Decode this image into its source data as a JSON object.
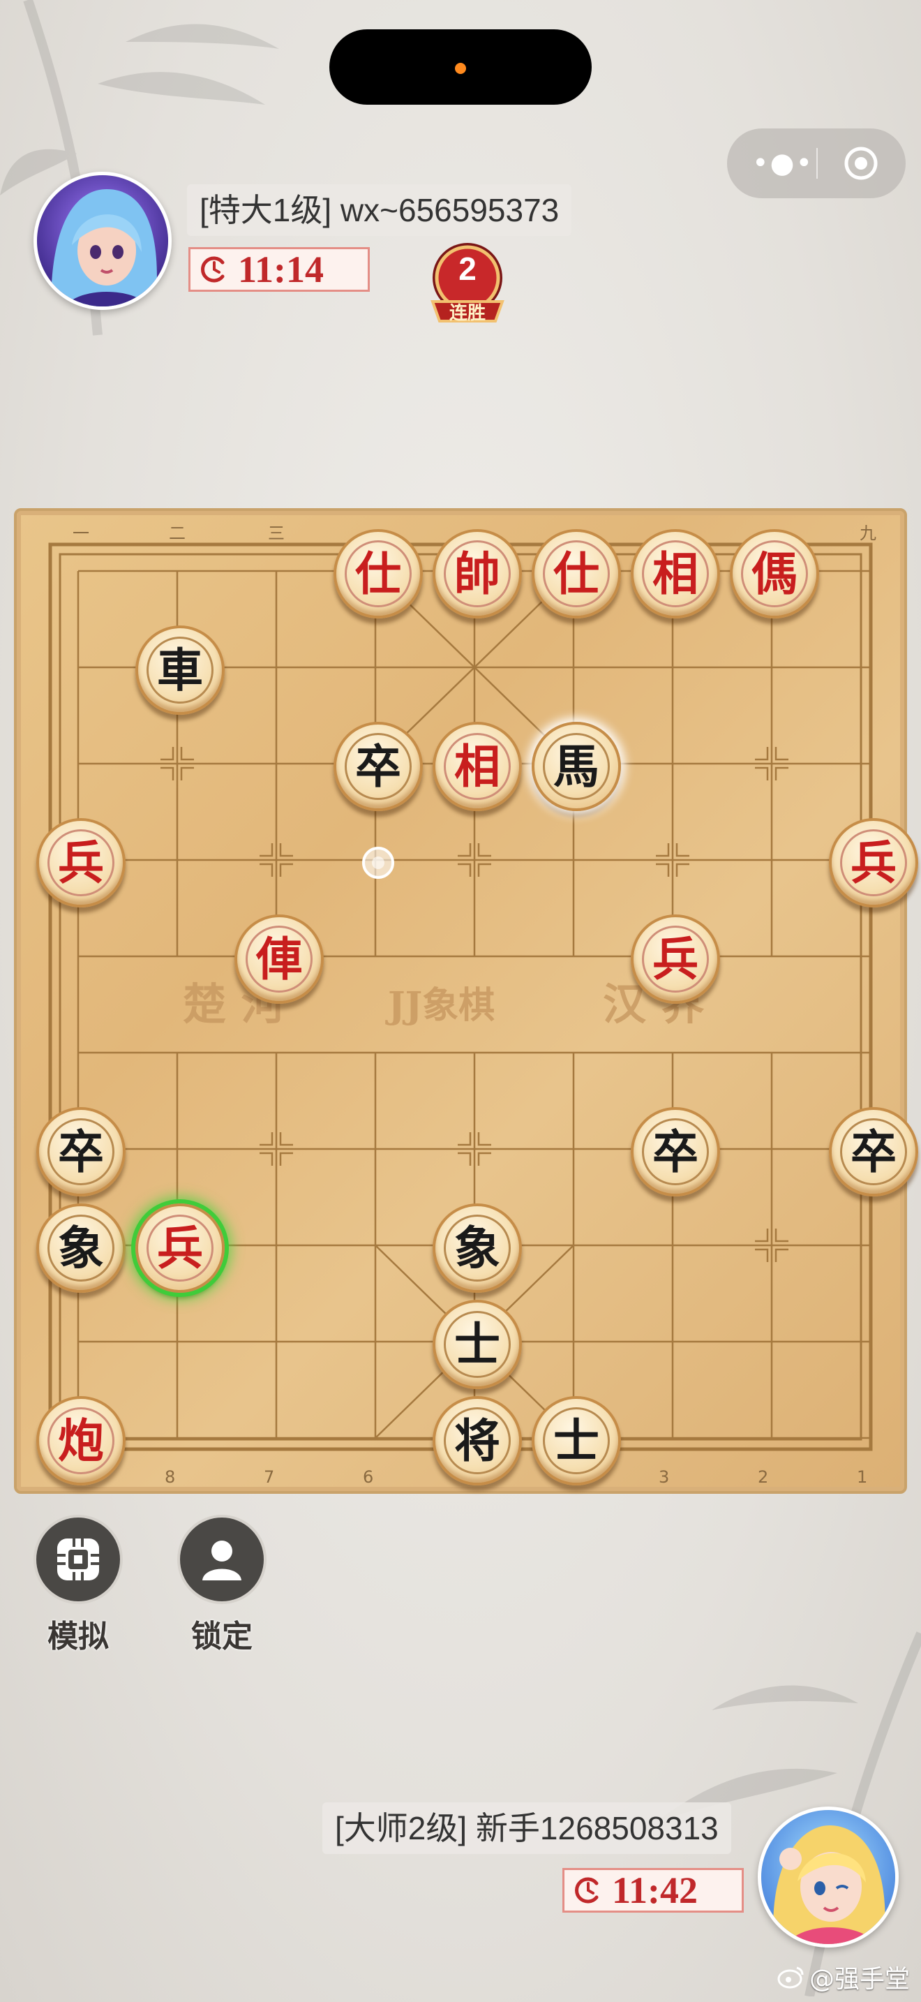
{
  "top_player": {
    "label": "[特大1级] wx~656595373",
    "timer": "11:14",
    "streak_count": "2",
    "streak_label": "连胜"
  },
  "bottom_player": {
    "label": "[大师2级] 新手1268508313",
    "timer": "11:42"
  },
  "board": {
    "top_files": [
      "一",
      "二",
      "三",
      "九"
    ],
    "bottom_files": [
      "8",
      "7",
      "6",
      "3",
      "2",
      "1"
    ],
    "river_left": "楚  河",
    "river_center": "JJ象棋",
    "river_right": "汉  界",
    "pieces": [
      {
        "char": "仕",
        "color": "red",
        "col": 3,
        "row": 0
      },
      {
        "char": "帥",
        "color": "red",
        "col": 4,
        "row": 0
      },
      {
        "char": "仕",
        "color": "red",
        "col": 5,
        "row": 0
      },
      {
        "char": "相",
        "color": "red",
        "col": 6,
        "row": 0
      },
      {
        "char": "傌",
        "color": "red",
        "col": 7,
        "row": 0
      },
      {
        "char": "車",
        "color": "black",
        "col": 1,
        "row": 1
      },
      {
        "char": "卒",
        "color": "black",
        "col": 3,
        "row": 2
      },
      {
        "char": "相",
        "color": "red",
        "col": 4,
        "row": 2
      },
      {
        "char": "馬",
        "color": "black",
        "col": 5,
        "row": 2,
        "state": "glow"
      },
      {
        "char": "兵",
        "color": "red",
        "col": 0,
        "row": 3
      },
      {
        "char": "兵",
        "color": "red",
        "col": 8,
        "row": 3
      },
      {
        "char": "俥",
        "color": "red",
        "col": 2,
        "row": 4
      },
      {
        "char": "兵",
        "color": "red",
        "col": 6,
        "row": 4
      },
      {
        "char": "卒",
        "color": "black",
        "col": 0,
        "row": 6
      },
      {
        "char": "卒",
        "color": "black",
        "col": 6,
        "row": 6
      },
      {
        "char": "卒",
        "color": "black",
        "col": 8,
        "row": 6
      },
      {
        "char": "象",
        "color": "black",
        "col": 0,
        "row": 7
      },
      {
        "char": "兵",
        "color": "red",
        "col": 1,
        "row": 7,
        "state": "highlight"
      },
      {
        "char": "象",
        "color": "black",
        "col": 4,
        "row": 7
      },
      {
        "char": "士",
        "color": "black",
        "col": 4,
        "row": 8
      },
      {
        "char": "炮",
        "color": "red",
        "col": 0,
        "row": 9
      },
      {
        "char": "将",
        "color": "black",
        "col": 4,
        "row": 9
      },
      {
        "char": "士",
        "color": "black",
        "col": 5,
        "row": 9
      }
    ],
    "last_move_from": {
      "col": 3,
      "row": 3
    }
  },
  "tools": {
    "simulate_label": "模拟",
    "lock_label": "锁定"
  },
  "menu": {
    "more_icon": "more-dots-icon",
    "close_icon": "target-close-icon"
  },
  "watermark": "@强手堂",
  "colors": {
    "red_piece": "#c81e1e",
    "black_piece": "#1a1a1a",
    "timer_red": "#c0282a",
    "highlight_green": "#3fcc3a"
  }
}
